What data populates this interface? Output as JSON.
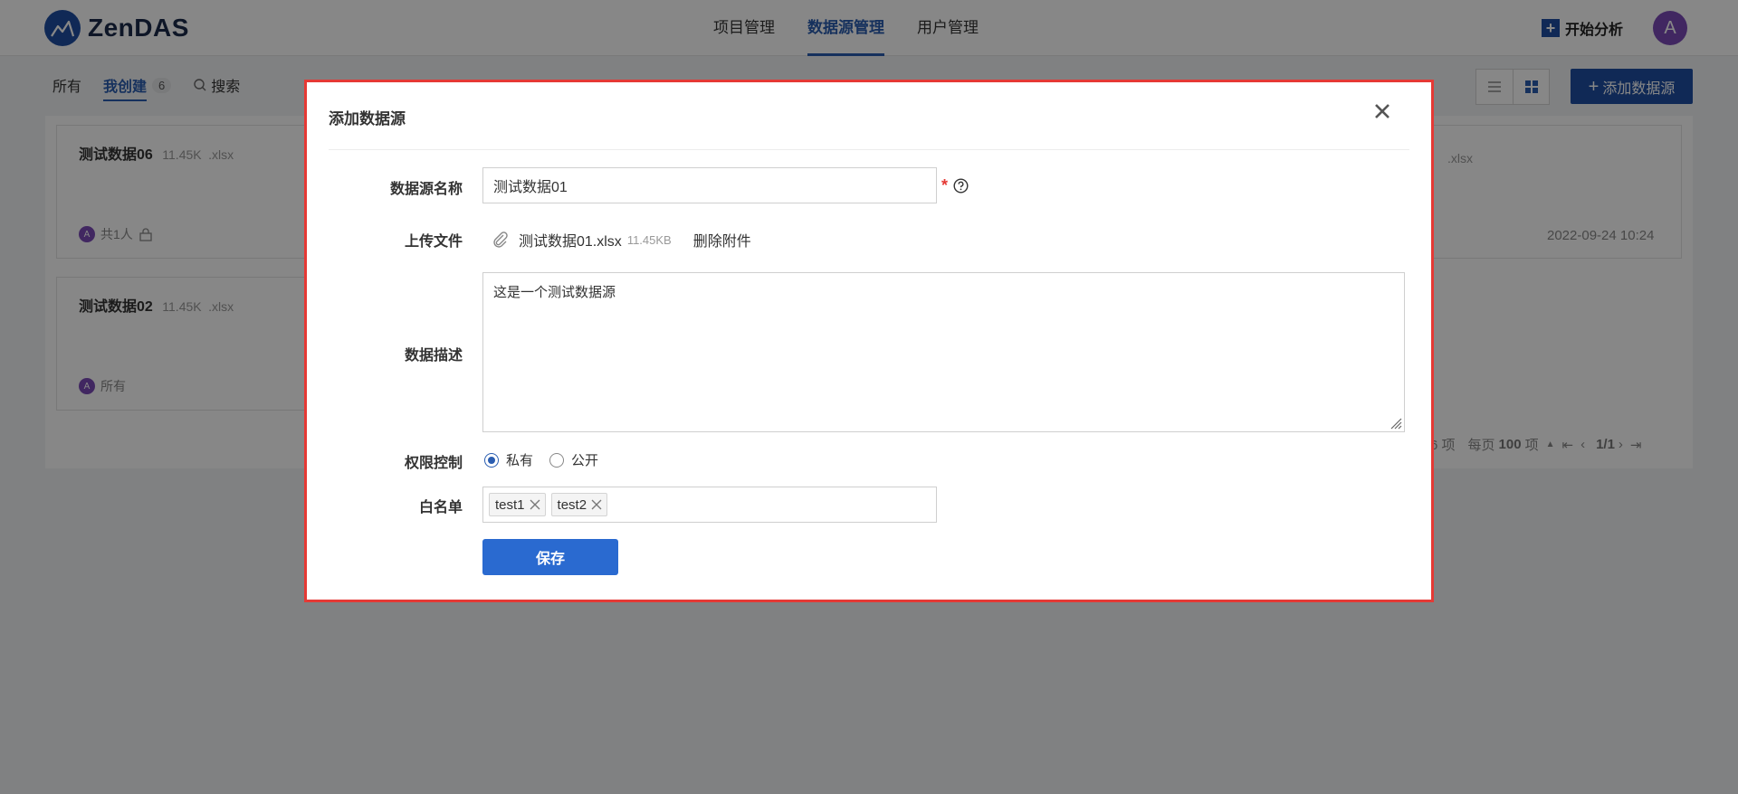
{
  "header": {
    "logo_text": "ZenDAS",
    "nav": [
      {
        "label": "项目管理"
      },
      {
        "label": "数据源管理",
        "active": true
      },
      {
        "label": "用户管理"
      }
    ],
    "start_label": "开始分析",
    "avatar_letter": "A"
  },
  "toolbar": {
    "filter_all": "所有",
    "filter_mine": "我创建",
    "mine_count": "6",
    "search_label": "搜索",
    "add_label": "添加数据源"
  },
  "cards": [
    {
      "name": "测试数据06",
      "size": "11.45K",
      "ext": ".xlsx",
      "footer": "共1人",
      "avatar": "A"
    },
    {
      "name": "测试数据02",
      "size": "11.45K",
      "ext": ".xlsx",
      "footer": "所有",
      "avatar": "A"
    }
  ],
  "right_card": {
    "ext": ".xlsx",
    "date": "2022-09-24 10:24"
  },
  "pager": {
    "total_suffix": "6 项",
    "per_page_prefix": "每页",
    "per_page": "100",
    "per_page_suffix": "项",
    "page": "1/1"
  },
  "modal": {
    "title": "添加数据源",
    "name_label": "数据源名称",
    "name_value": "测试数据01",
    "required_mark": "*",
    "upload_label": "上传文件",
    "file_name": "测试数据01.xlsx",
    "file_size": "11.45KB",
    "delete_label": "删除附件",
    "desc_label": "数据描述",
    "desc_value": "这是一个测试数据源",
    "perm_label": "权限控制",
    "perm_private": "私有",
    "perm_public": "公开",
    "whitelist_label": "白名单",
    "tags": [
      "test1",
      "test2"
    ],
    "save_label": "保存"
  },
  "colors": {
    "accent": "#2a5db0",
    "brand": "#1f4fa3",
    "modal_border": "#e53935"
  }
}
